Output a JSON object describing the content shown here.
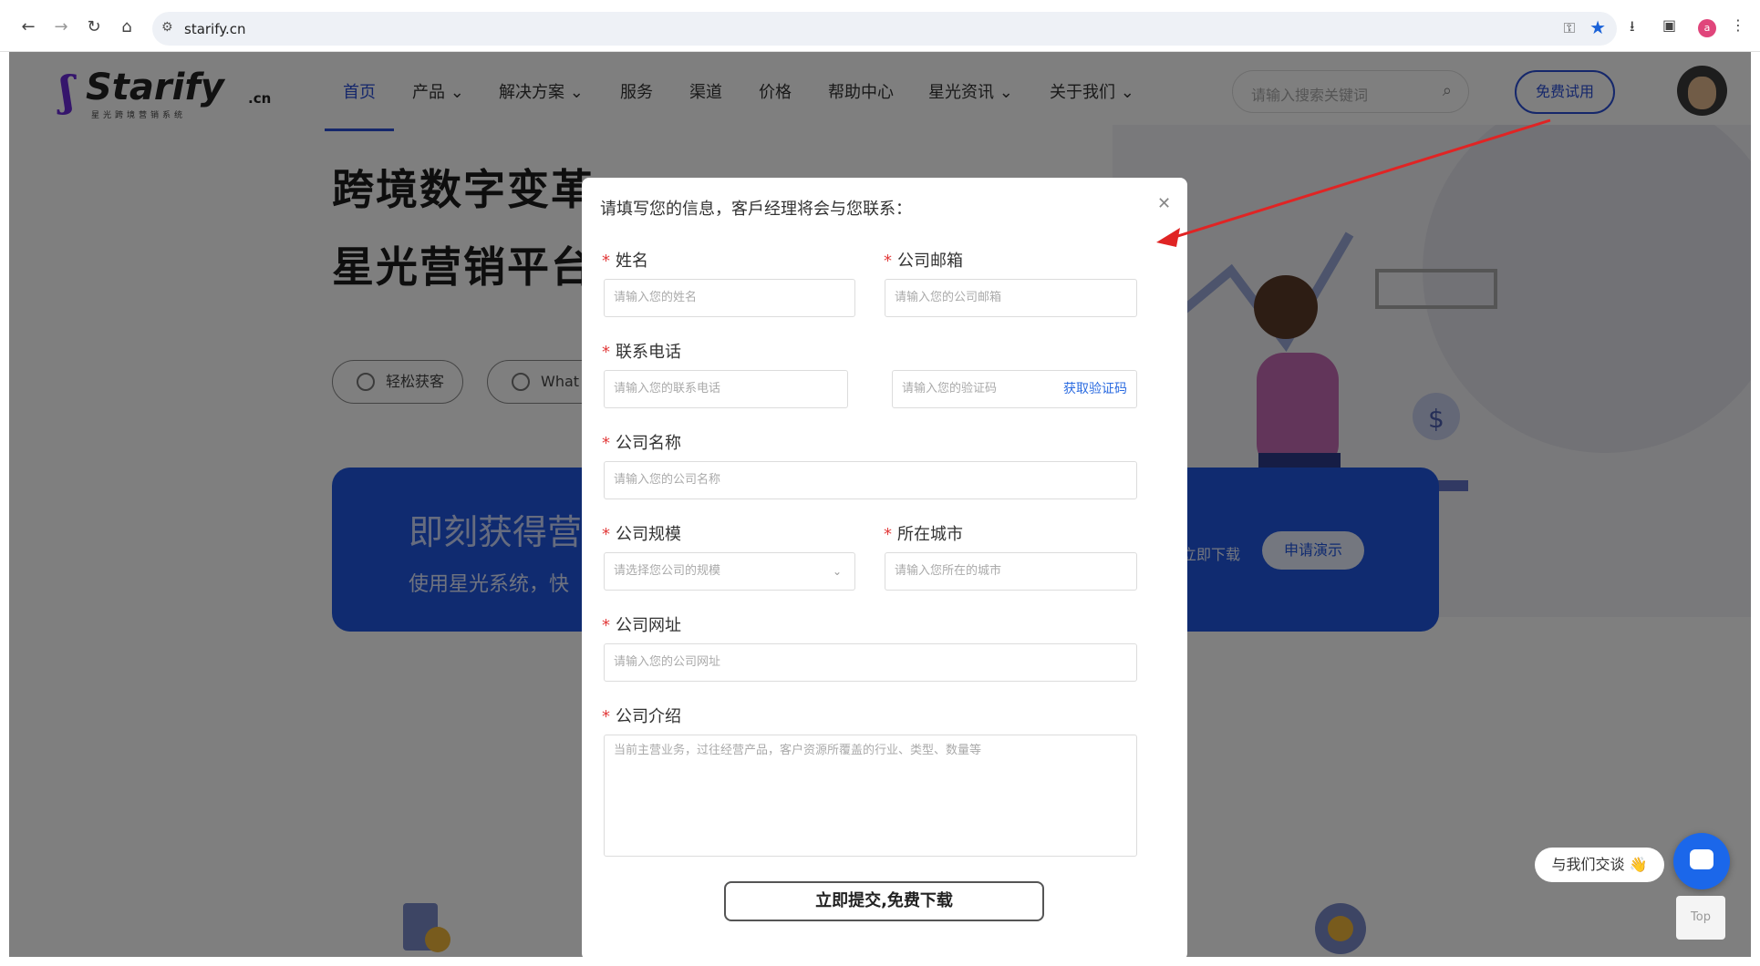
{
  "browser": {
    "url": "starify.cn",
    "profile_initial": "a"
  },
  "nav": {
    "logo_main": "Starify",
    "logo_suffix": ".cn",
    "logo_sub": "星光跨境营销系统",
    "items": [
      {
        "label": "首页"
      },
      {
        "label": "产品 ⌄"
      },
      {
        "label": "解决方案 ⌄"
      },
      {
        "label": "服务"
      },
      {
        "label": "渠道"
      },
      {
        "label": "价格"
      },
      {
        "label": "帮助中心"
      },
      {
        "label": "星光资讯 ⌄"
      },
      {
        "label": "关于我们 ⌄"
      }
    ],
    "search_placeholder": "请输入搜索关键词",
    "trial_button": "免费试用"
  },
  "hero": {
    "title_line1": "跨境数字变革",
    "title_line2": "星光营销平台",
    "pill1": "轻松获客",
    "pill2": "What"
  },
  "banner": {
    "title": "即刻获得营",
    "subtitle": "使用星光系统，快",
    "download": "立即下载",
    "demo": "申请演示"
  },
  "modal": {
    "title": "请填写您的信息，客戶经理将会与您联系：",
    "required_mark": "*",
    "fields": {
      "name": {
        "label": "姓名",
        "placeholder": "请输入您的姓名"
      },
      "email": {
        "label": "公司邮箱",
        "placeholder": "请输入您的公司邮箱"
      },
      "phone": {
        "label": "联系电话",
        "placeholder": "请输入您的联系电话"
      },
      "code": {
        "placeholder": "请输入您的验证码",
        "action": "获取验证码"
      },
      "company": {
        "label": "公司名称",
        "placeholder": "请输入您的公司名称"
      },
      "size": {
        "label": "公司规模",
        "placeholder": "请选择您公司的规模"
      },
      "city": {
        "label": "所在城市",
        "placeholder": "请输入您所在的城市"
      },
      "website": {
        "label": "公司网址",
        "placeholder": "请输入您的公司网址"
      },
      "intro": {
        "label": "公司介绍",
        "placeholder": "当前主营业务，过往经营产品，客户资源所覆盖的行业、类型、数量等"
      }
    },
    "submit": "立即提交,免费下载"
  },
  "chat": {
    "tip": "与我们交谈 👋",
    "top": "Top"
  },
  "colors": {
    "brand_blue": "#2b4fd6",
    "banner_blue": "#2157e0",
    "required_red": "#e23b3b",
    "arrow_red": "#e02424"
  }
}
